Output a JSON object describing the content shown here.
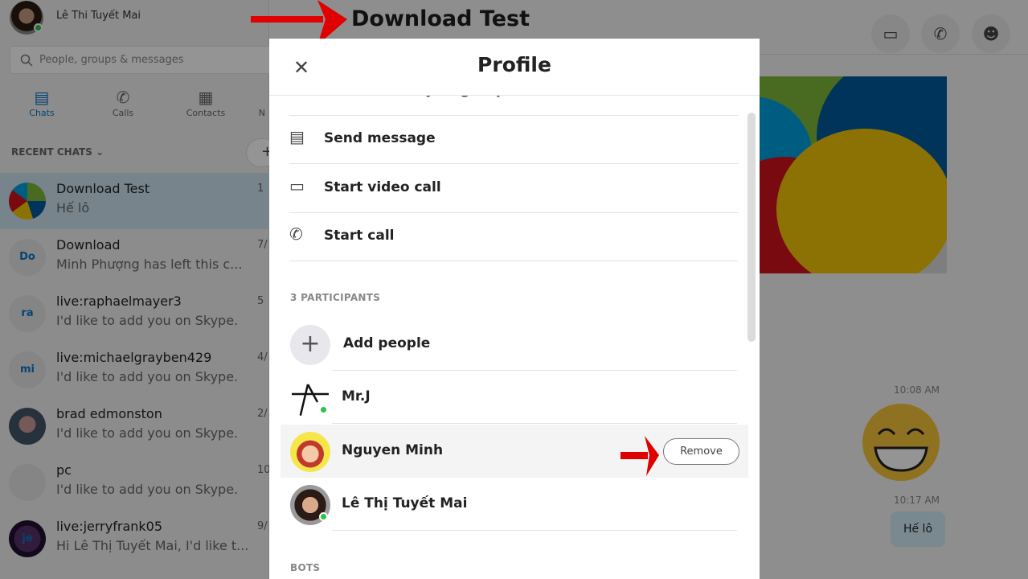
{
  "user": {
    "name": "Lê Thi Tuyết Mai",
    "status": "online"
  },
  "search": {
    "placeholder": "People, groups & messages"
  },
  "tabs": [
    {
      "label": "Chats",
      "icon": "chat-icon",
      "active": true
    },
    {
      "label": "Calls",
      "icon": "phone-icon"
    },
    {
      "label": "Contacts",
      "icon": "contacts-icon"
    },
    {
      "label": "N"
    }
  ],
  "recent_chats": {
    "label": "RECENT CHATS",
    "add": "+"
  },
  "chats": [
    {
      "initials": "",
      "name": "Download Test",
      "msg": "Hế lô",
      "date": "1",
      "selected": true
    },
    {
      "initials": "Do",
      "name": "Download",
      "msg": "Minh Phượng has left this c...",
      "date": "7/"
    },
    {
      "initials": "ra",
      "name": "live:raphaelmayer3",
      "msg": "I'd like to add you on Skype.",
      "date": "5"
    },
    {
      "initials": "mi",
      "name": "live:michaelgrayben429",
      "msg": "I'd like to add you on Skype.",
      "date": "4/"
    },
    {
      "initials": "",
      "name": "brad edmonston",
      "msg": "I'd like to add you on Skype.",
      "date": "2/"
    },
    {
      "initials": "",
      "name": "pc",
      "msg": "I'd like to add you on Skype.",
      "date": "10"
    },
    {
      "initials": "je",
      "name": "live:jerryfrank05",
      "msg": "Hi Lê Thị Tuyết Mai, I'd like t...",
      "date": "9/"
    }
  ],
  "conversation": {
    "title": "Download Test",
    "header_buttons": [
      "video-call",
      "call",
      "add-person"
    ],
    "messages": [
      {
        "time": "10:08 AM",
        "type": "emoji"
      },
      {
        "time": "10:17 AM",
        "text": "Hế lô"
      }
    ]
  },
  "profile": {
    "title": "Profile",
    "partial_item": "Share link to join group",
    "actions": [
      {
        "label": "Send message",
        "icon": "message-icon"
      },
      {
        "label": "Start video call",
        "icon": "video-icon"
      },
      {
        "label": "Start call",
        "icon": "phone-icon"
      }
    ],
    "participants_label": "3 PARTICIPANTS",
    "add_people": "Add people",
    "participants": [
      {
        "name": "Mr.J",
        "online": true
      },
      {
        "name": "Nguyen Minh",
        "highlighted": true,
        "action": "Remove"
      },
      {
        "name": "Lê Thị Tuyết Mai",
        "online": true
      }
    ],
    "bots_label": "BOTS"
  },
  "colors": {
    "accent": "#0a75c9",
    "online": "#2bc34a",
    "annotation": "#e00000"
  }
}
